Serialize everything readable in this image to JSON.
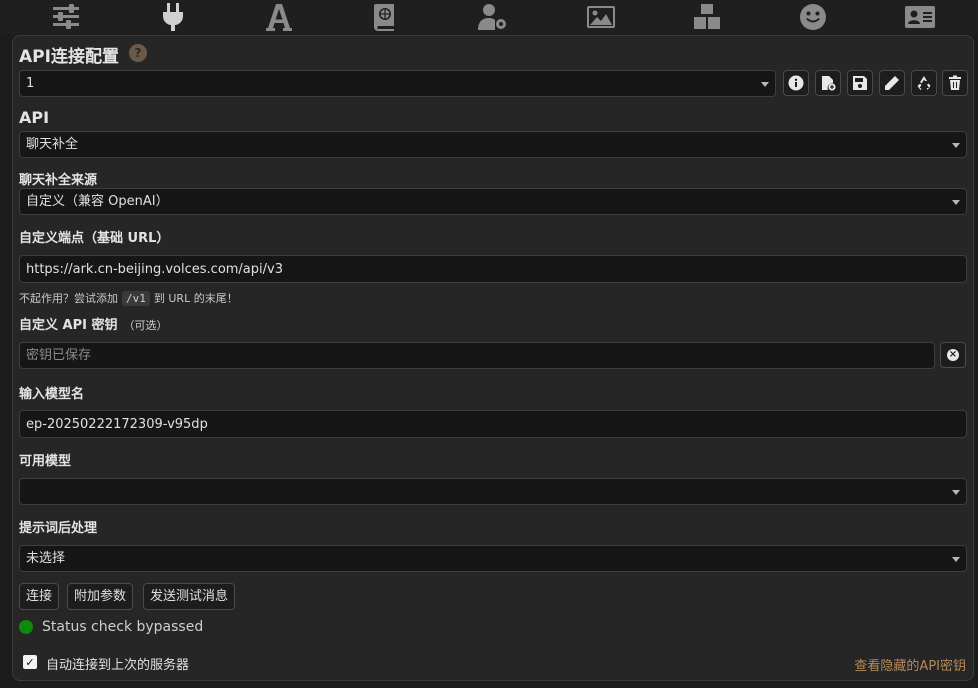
{
  "top_nav": {
    "icons": [
      "sliders-icon",
      "plug-icon",
      "font-icon",
      "book-globe-icon",
      "user-gear-icon",
      "image-icon",
      "cubes-icon",
      "smiley-icon",
      "id-card-icon"
    ],
    "active": "plug-icon"
  },
  "panel": {
    "title": "API连接配置",
    "help_glyph": "?",
    "profile_select_value": "1",
    "api_label": "API",
    "api_select_value": "聊天补全",
    "source_label": "聊天补全来源",
    "source_select_value": "自定义（兼容 OpenAI）",
    "endpoint_label": "自定义端点（基础 URL）",
    "endpoint_value": "https://ark.cn-beijing.volces.com/api/v3",
    "hint_prefix": "不起作用？尝试添加",
    "hint_code": "/v1",
    "hint_suffix": "到 URL 的末尾！",
    "key_label": "自定义 API 密钥",
    "key_label_sub": "（可选）",
    "key_placeholder": "密钥已保存",
    "model_label": "输入模型名",
    "model_value": "ep-20250222172309-v95dp",
    "available_label": "可用模型",
    "available_value": "",
    "postproc_label": "提示词后处理",
    "postproc_value": "未选择",
    "buttons": {
      "connect": "连接",
      "extra_params": "附加参数",
      "send_test": "发送测试消息"
    },
    "status_text": "Status check bypassed",
    "auto_connect_label": "自动连接到上次的服务器",
    "auto_connect_checked": true,
    "view_keys_link": "查看隐藏的API密钥"
  },
  "colors": {
    "status_ok": "#0b8a0b",
    "link": "#b5895a"
  }
}
